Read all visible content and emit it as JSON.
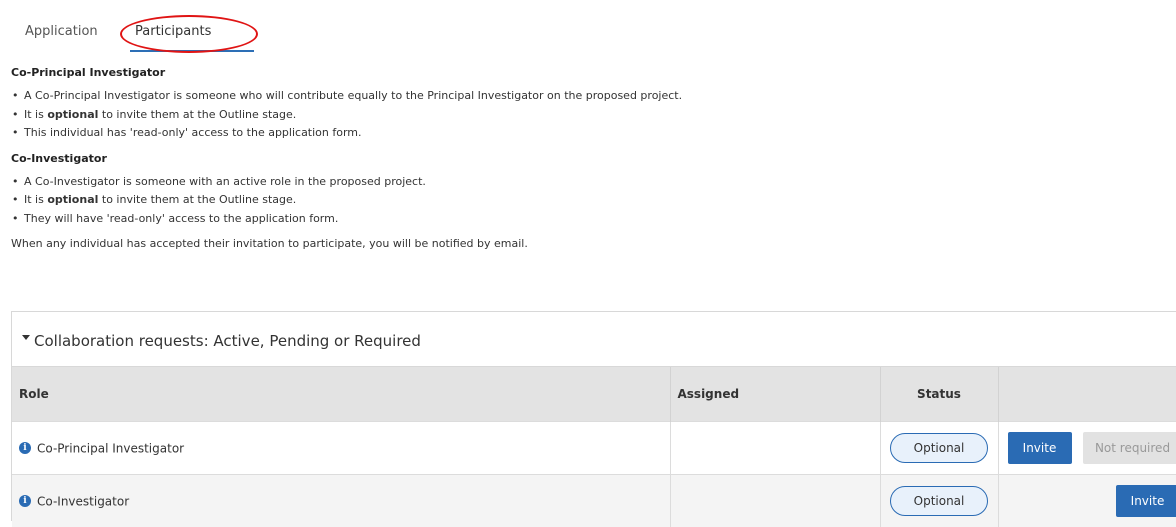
{
  "tabs": [
    {
      "label": "Application"
    },
    {
      "label": "Participants"
    }
  ],
  "sections": [
    {
      "heading": "Co-Principal Investigator",
      "bullets": [
        {
          "text": "A Co-Principal Investigator is someone who will contribute equally to the Principal Investigator on the proposed project."
        },
        {
          "pre": "It is ",
          "bold": "optional",
          "post": " to invite them at the Outline stage."
        },
        {
          "text": "This individual has 'read-only' access to the application form."
        }
      ]
    },
    {
      "heading": "Co-Investigator",
      "bullets": [
        {
          "text": "A Co-Investigator is someone with an active role in the proposed project."
        },
        {
          "pre": "It is ",
          "bold": "optional",
          "post": " to invite them at the Outline stage."
        },
        {
          "text": "They will have 'read-only' access to the application form."
        }
      ]
    }
  ],
  "note": "When any individual has accepted their invitation to participate, you will be notified by email.",
  "panel": {
    "title": "Collaboration requests: Active, Pending or Required",
    "columns": {
      "role": "Role",
      "assigned": "Assigned",
      "status": "Status"
    },
    "rows": [
      {
        "role": "Co-Principal Investigator",
        "assigned": "",
        "status": "Optional",
        "invite_label": "Invite",
        "not_required_label": "Not required"
      },
      {
        "role": "Co-Investigator",
        "assigned": "",
        "status": "Optional",
        "invite_label": "Invite"
      }
    ]
  },
  "colors": {
    "accent": "#2a6bb4",
    "highlight_circle": "#e01414"
  },
  "icons": {
    "info": "info-icon",
    "caret": "caret-down-icon"
  }
}
